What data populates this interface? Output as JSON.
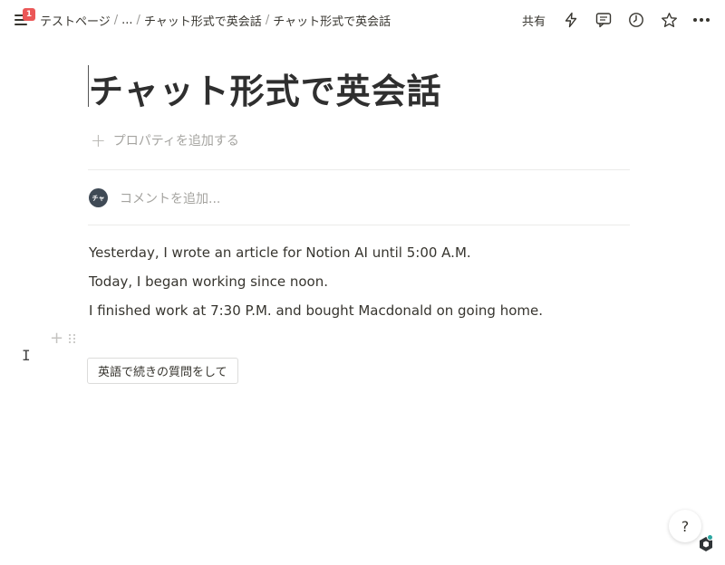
{
  "topbar": {
    "notification_count": "1",
    "breadcrumb": [
      {
        "label": "テストページ"
      },
      {
        "label": "..."
      },
      {
        "label": "チャット形式で英会話"
      },
      {
        "label": "チャット形式で英会話"
      }
    ],
    "separator": "/",
    "share_label": "共有",
    "icons": [
      "menu-icon",
      "lightning-icon",
      "comment-icon",
      "clock-icon",
      "star-icon",
      "more-icon"
    ]
  },
  "page": {
    "title": "チャット形式で英会話",
    "add_property_label": "プロパティを追加する",
    "add_property_icon": "plus-icon",
    "comment_avatar_text": "チャ",
    "comment_placeholder": "コメントを追加...",
    "paragraphs": [
      "Yesterday, I wrote an article for Notion AI until 5:00 A.M.",
      "Today, I began working since noon.",
      "I finished work at 7:30 P.M. and bought Macdonald on going home."
    ],
    "template_button_label": "英語で続きの質問をして"
  },
  "help": {
    "label": "?"
  },
  "colors": {
    "badge": "#eb5757",
    "text": "#37352f",
    "muted": "#a5a4a0",
    "divider": "#ebebea",
    "ai_dot": "#2ba6a0"
  }
}
